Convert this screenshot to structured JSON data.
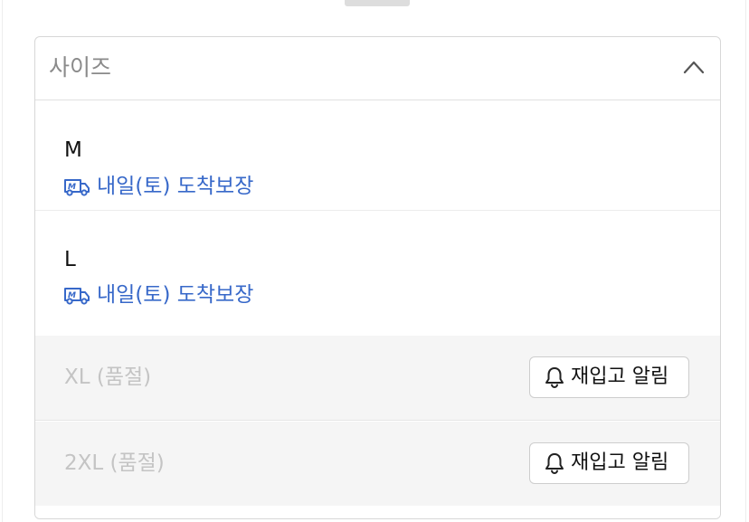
{
  "dropdown": {
    "title": "사이즈",
    "expanded": true
  },
  "options": [
    {
      "size": "M",
      "delivery": "내일(토) 도착보장",
      "available": true
    },
    {
      "size": "L",
      "delivery": "내일(토) 도착보장",
      "available": true
    },
    {
      "size": "XL (품절)",
      "available": false,
      "restock_label": "재입고 알림"
    },
    {
      "size": "2XL (품절)",
      "available": false,
      "restock_label": "재입고 알림"
    }
  ],
  "colors": {
    "delivery": "#3768c9",
    "soldout_text": "#c4c4c4",
    "soldout_bg": "#f5f5f5"
  },
  "icons": {
    "header": "chevron-up-icon",
    "delivery": "delivery-truck-icon",
    "restock": "bell-icon"
  }
}
